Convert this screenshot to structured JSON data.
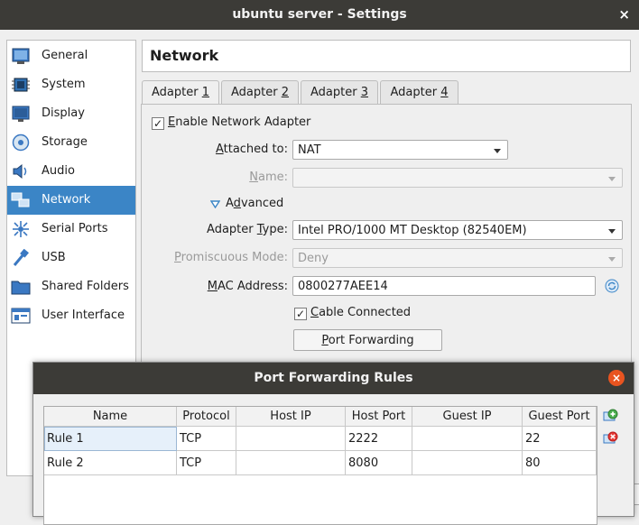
{
  "window": {
    "title": "ubuntu server - Settings",
    "close_glyph": "×"
  },
  "sidebar": {
    "items": [
      {
        "label": "General",
        "icon": "general-icon"
      },
      {
        "label": "System",
        "icon": "system-icon"
      },
      {
        "label": "Display",
        "icon": "display-icon"
      },
      {
        "label": "Storage",
        "icon": "storage-icon"
      },
      {
        "label": "Audio",
        "icon": "audio-icon"
      },
      {
        "label": "Network",
        "icon": "network-icon",
        "selected": true
      },
      {
        "label": "Serial Ports",
        "icon": "serial-ports-icon"
      },
      {
        "label": "USB",
        "icon": "usb-icon"
      },
      {
        "label": "Shared Folders",
        "icon": "shared-folders-icon"
      },
      {
        "label": "User Interface",
        "icon": "user-interface-icon"
      }
    ]
  },
  "header": {
    "title": "Network"
  },
  "tabs": [
    {
      "pre": "Adapter ",
      "key": "1"
    },
    {
      "pre": "Adapter ",
      "key": "2"
    },
    {
      "pre": "Adapter ",
      "key": "3"
    },
    {
      "pre": "Adapter ",
      "key": "4"
    }
  ],
  "adapter": {
    "enable": {
      "key": "E",
      "rest": "nable Network Adapter",
      "checked": true
    },
    "attached": {
      "key": "A",
      "rest": "ttached to:",
      "value": "NAT"
    },
    "name": {
      "key": "N",
      "rest": "ame:",
      "value": ""
    },
    "advanced": {
      "pre": "A",
      "key": "d",
      "rest": "vanced"
    },
    "adapter_type": {
      "pre": "Adapter ",
      "key": "T",
      "rest": "ype:",
      "value": "Intel PRO/1000 MT Desktop (82540EM)"
    },
    "promiscuous": {
      "key": "P",
      "rest": "romiscuous Mode:",
      "value": "Deny"
    },
    "mac": {
      "key": "M",
      "rest": "AC Address:",
      "value": "0800277AEE14"
    },
    "cable": {
      "key": "C",
      "rest": "able Connected",
      "checked": true
    },
    "port_forwarding": {
      "key": "P",
      "rest": "ort Forwarding"
    }
  },
  "dialog": {
    "title": "Port Forwarding Rules",
    "close_glyph": "×",
    "columns": [
      "Name",
      "Protocol",
      "Host IP",
      "Host Port",
      "Guest IP",
      "Guest Port"
    ],
    "rows": [
      [
        "Rule 1",
        "TCP",
        "",
        "2222",
        "",
        "22"
      ],
      [
        "Rule 2",
        "TCP",
        "",
        "8080",
        "",
        "80"
      ]
    ]
  },
  "colors": {
    "accent": "#3b85c6",
    "titlebar": "#3c3b37",
    "close": "#e95420"
  }
}
